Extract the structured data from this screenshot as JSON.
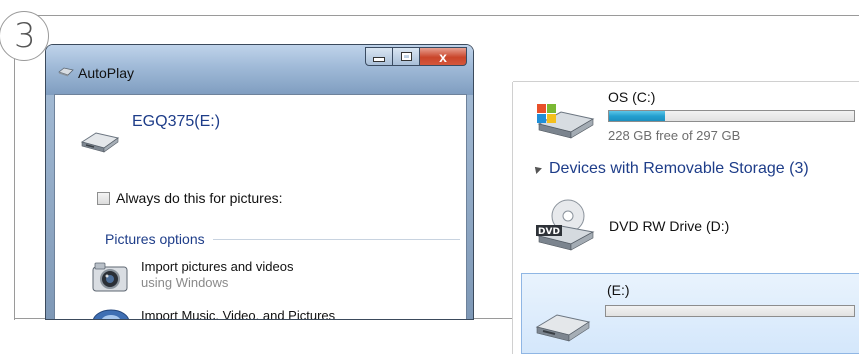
{
  "step": {
    "number": "3"
  },
  "autoplay": {
    "title": "AutoPlay",
    "device_name": "EGQ375(E:)",
    "always_do_label": "Always do this for pictures:",
    "always_do_checked": false,
    "section_title": "Pictures options",
    "options": [
      {
        "title": "Import pictures and videos",
        "subtitle": "using Windows",
        "icon": "camera-icon"
      },
      {
        "title": "Import Music, Video, and Pictures",
        "icon": "media-import-icon"
      }
    ],
    "caption_buttons": {
      "close": "x"
    }
  },
  "explorer": {
    "drives": [
      {
        "label": "OS (C:)",
        "free_text": "228 GB free of 297 GB",
        "used_fraction": 0.23,
        "icon": "windows-drive-icon"
      }
    ],
    "group": {
      "title": "Devices with Removable Storage (3)"
    },
    "devices": [
      {
        "label": "DVD RW Drive (D:)",
        "icon": "dvd-drive-icon",
        "badge": "DVD"
      },
      {
        "label": "(E:)",
        "used_fraction": 0.0,
        "icon": "removable-drive-icon",
        "selected": true
      }
    ]
  },
  "colors": {
    "link_blue": "#1e3d89",
    "bar_blue": "#25a0d0",
    "selection": "#d4e7fb"
  }
}
